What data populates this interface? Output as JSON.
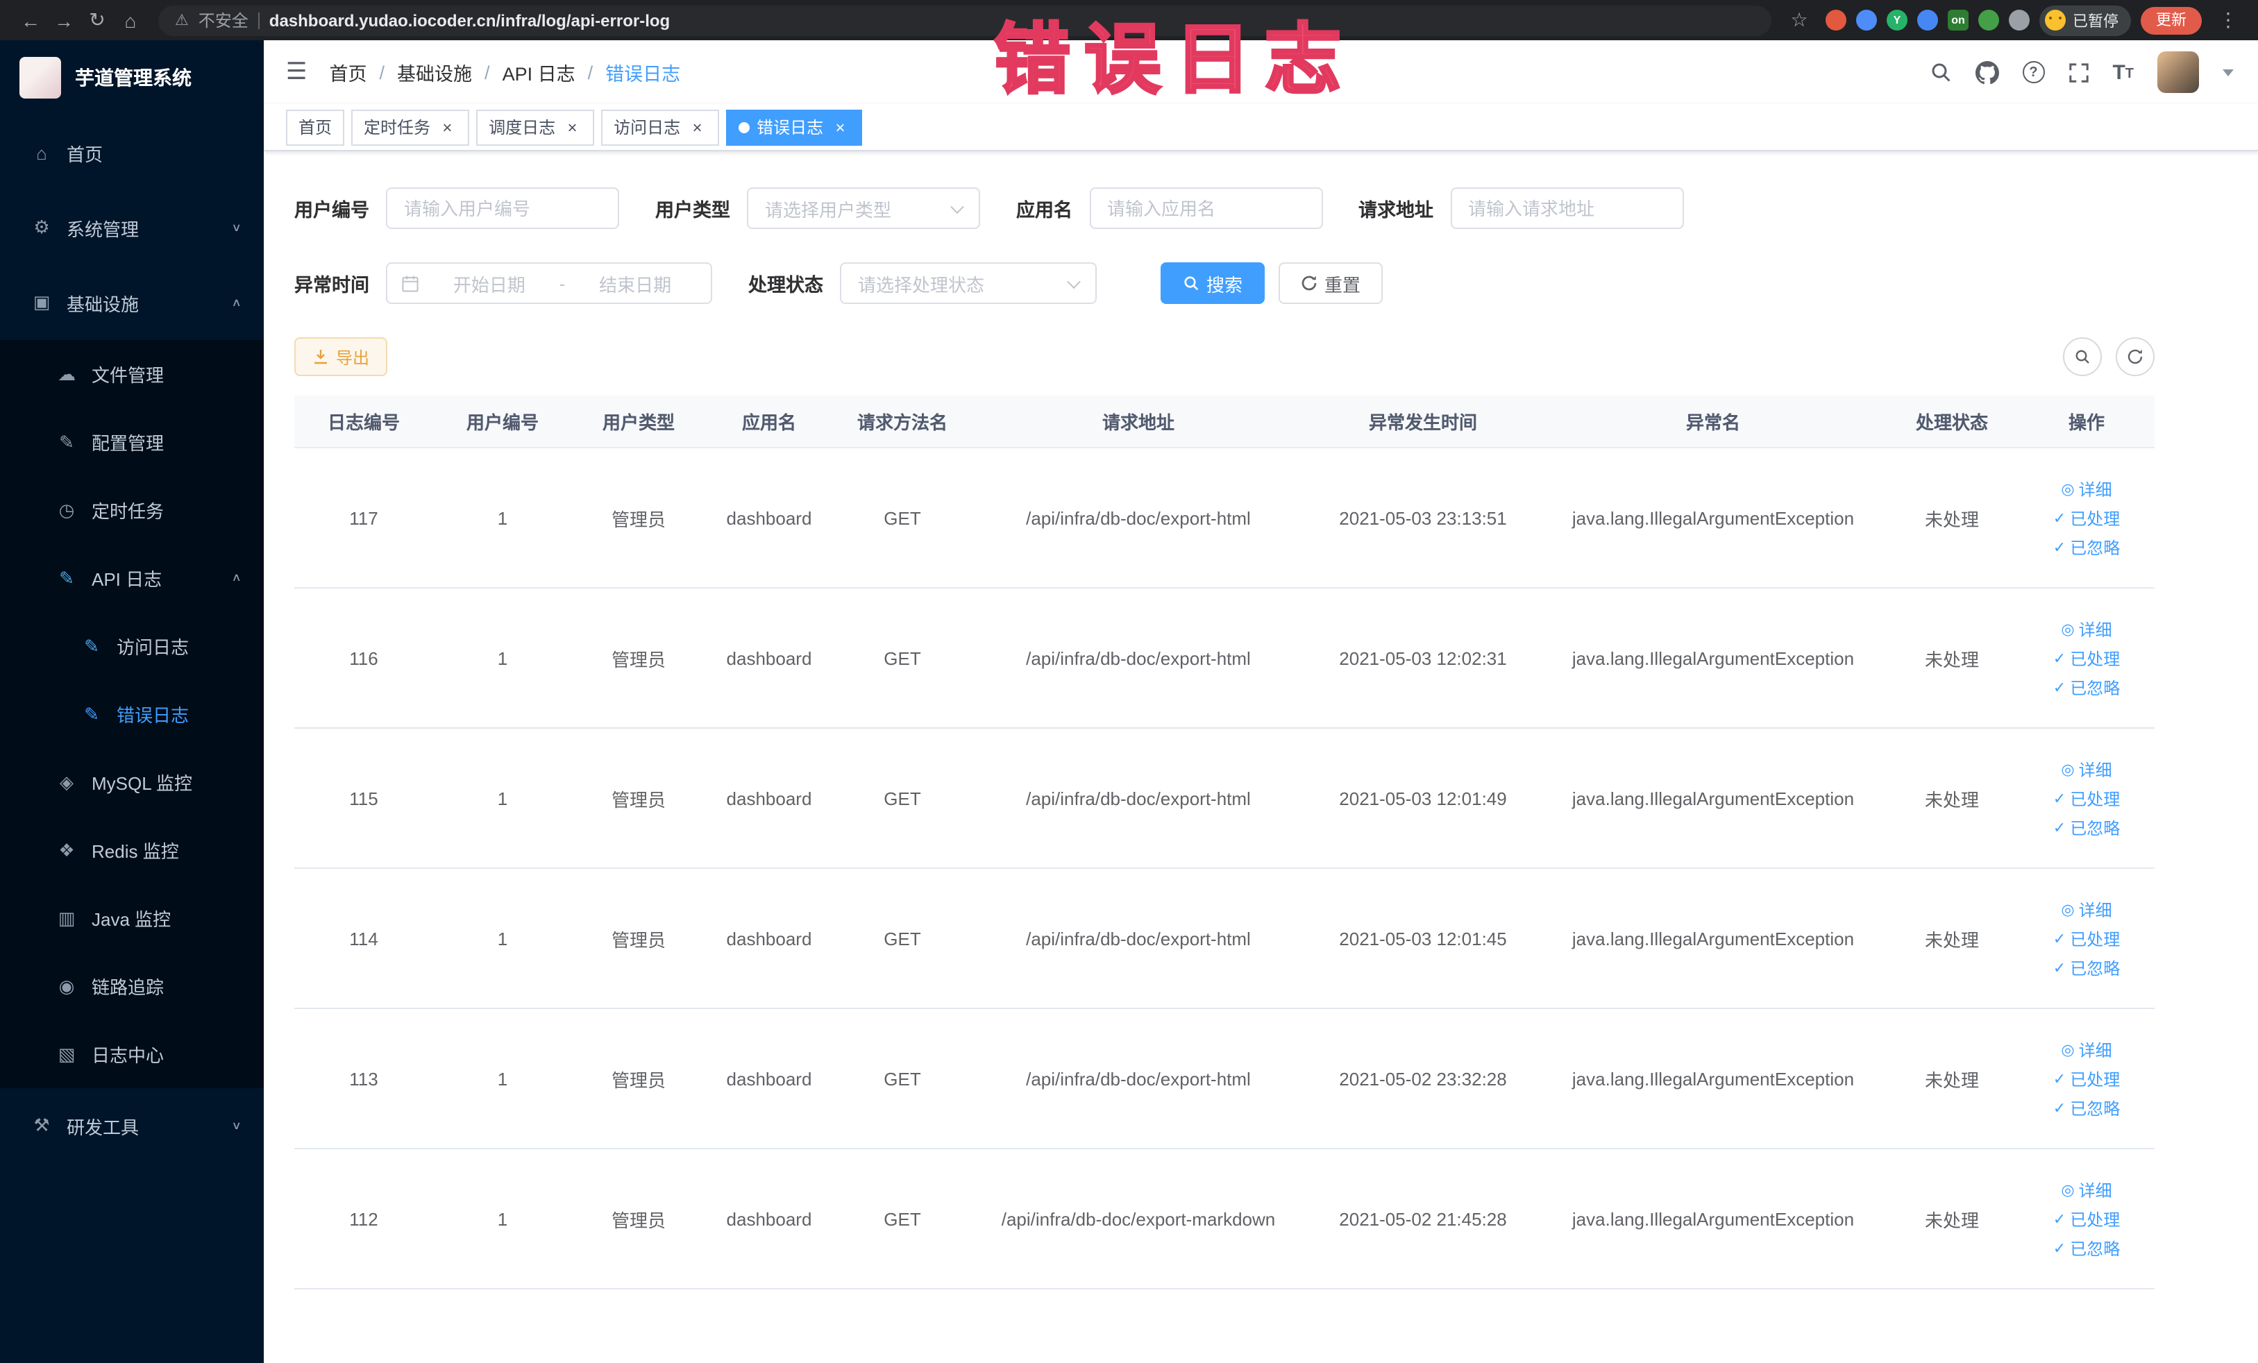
{
  "theme": {
    "primary": "#409eff",
    "sidebar_bg": "#001529",
    "submenu_bg": "#000c17",
    "warning_text": "#e6a23c",
    "warning_bg": "#fdf6ec",
    "warning_border": "#f5dab1",
    "annotation_color": "#f2557a"
  },
  "annotation": "错误日志",
  "browser": {
    "security_label": "不安全",
    "url": "dashboard.yudao.iocoder.cn/infra/log/api-error-log",
    "profile_badge": "已暂停",
    "update_label": "更新",
    "extensions": [
      {
        "name": "extension-orange-circle",
        "color": "#e2593f",
        "label": ""
      },
      {
        "name": "extension-blue-drop",
        "color": "#4e8cf7",
        "label": ""
      },
      {
        "name": "extension-green-y",
        "color": "#27b26a",
        "label": "Y"
      },
      {
        "name": "extension-blue-grid",
        "color": "#4687f4",
        "label": ""
      },
      {
        "name": "extension-on-badge",
        "color": "#2e7d32",
        "label": "on"
      },
      {
        "name": "extension-green-leaf",
        "color": "#43a047",
        "label": ""
      },
      {
        "name": "extension-pinwheel",
        "color": "#9aa0a6",
        "label": ""
      }
    ]
  },
  "sidebar": {
    "logo_title": "芋道管理系统",
    "items": [
      {
        "label": "首页",
        "icon": "home",
        "level": 1
      },
      {
        "label": "系统管理",
        "icon": "system",
        "level": 1,
        "chevron": "down"
      },
      {
        "label": "基础设施",
        "icon": "infra",
        "level": 1,
        "chevron": "up"
      },
      {
        "label": "文件管理",
        "icon": "file",
        "level": 2,
        "in_submenu": true
      },
      {
        "label": "配置管理",
        "icon": "config",
        "level": 2,
        "in_submenu": true
      },
      {
        "label": "定时任务",
        "icon": "cron",
        "level": 2,
        "in_submenu": true
      },
      {
        "label": "API 日志",
        "icon": "api-log",
        "level": 2,
        "in_submenu": true,
        "chevron": "up",
        "icon_accent": true
      },
      {
        "label": "访问日志",
        "icon": "access-log",
        "level": 3,
        "in_submenu": true,
        "icon_accent": true
      },
      {
        "label": "错误日志",
        "icon": "error-log",
        "level": 3,
        "in_submenu": true,
        "icon_accent": true,
        "active": true
      },
      {
        "label": "MySQL 监控",
        "icon": "mysql",
        "level": 2,
        "in_submenu": true
      },
      {
        "label": "Redis 监控",
        "icon": "redis",
        "level": 2,
        "in_submenu": true
      },
      {
        "label": "Java 监控",
        "icon": "java",
        "level": 2,
        "in_submenu": true
      },
      {
        "label": "链路追踪",
        "icon": "trace",
        "level": 2,
        "in_submenu": true
      },
      {
        "label": "日志中心",
        "icon": "log-center",
        "level": 2,
        "in_submenu": true
      },
      {
        "label": "研发工具",
        "icon": "devtools",
        "level": 1,
        "chevron": "down"
      }
    ]
  },
  "header": {
    "breadcrumb": [
      {
        "label": "首页"
      },
      {
        "label": "基础设施"
      },
      {
        "label": "API 日志"
      },
      {
        "label": "错误日志",
        "active": true
      }
    ]
  },
  "tabs": [
    {
      "label": "首页",
      "closable": false
    },
    {
      "label": "定时任务",
      "closable": true
    },
    {
      "label": "调度日志",
      "closable": true
    },
    {
      "label": "访问日志",
      "closable": true
    },
    {
      "label": "错误日志",
      "closable": true,
      "active": true
    }
  ],
  "filters": {
    "user_id_label": "用户编号",
    "user_id_placeholder": "请输入用户编号",
    "user_type_label": "用户类型",
    "user_type_placeholder": "请选择用户类型",
    "app_name_label": "应用名",
    "app_name_placeholder": "请输入应用名",
    "request_url_label": "请求地址",
    "request_url_placeholder": "请输入请求地址",
    "exception_time_label": "异常时间",
    "start_date_placeholder": "开始日期",
    "range_separator": "-",
    "end_date_placeholder": "结束日期",
    "process_status_label": "处理状态",
    "process_status_placeholder": "请选择处理状态",
    "search_button": "搜索",
    "reset_button": "重置"
  },
  "toolbar": {
    "export_button": "导出"
  },
  "table": {
    "columns": [
      "日志编号",
      "用户编号",
      "用户类型",
      "应用名",
      "请求方法名",
      "请求地址",
      "异常发生时间",
      "异常名",
      "处理状态",
      "操作"
    ],
    "actions": [
      "详细",
      "已处理",
      "已忽略"
    ],
    "rows": [
      {
        "id": "117",
        "user_id": "1",
        "user_type": "管理员",
        "app": "dashboard",
        "method": "GET",
        "url": "/api/infra/db-doc/export-html",
        "time": "2021-05-03 23:13:51",
        "exception": "java.lang.IllegalArgumentException",
        "status": "未处理"
      },
      {
        "id": "116",
        "user_id": "1",
        "user_type": "管理员",
        "app": "dashboard",
        "method": "GET",
        "url": "/api/infra/db-doc/export-html",
        "time": "2021-05-03 12:02:31",
        "exception": "java.lang.IllegalArgumentException",
        "status": "未处理"
      },
      {
        "id": "115",
        "user_id": "1",
        "user_type": "管理员",
        "app": "dashboard",
        "method": "GET",
        "url": "/api/infra/db-doc/export-html",
        "time": "2021-05-03 12:01:49",
        "exception": "java.lang.IllegalArgumentException",
        "status": "未处理"
      },
      {
        "id": "114",
        "user_id": "1",
        "user_type": "管理员",
        "app": "dashboard",
        "method": "GET",
        "url": "/api/infra/db-doc/export-html",
        "time": "2021-05-03 12:01:45",
        "exception": "java.lang.IllegalArgumentException",
        "status": "未处理"
      },
      {
        "id": "113",
        "user_id": "1",
        "user_type": "管理员",
        "app": "dashboard",
        "method": "GET",
        "url": "/api/infra/db-doc/export-html",
        "time": "2021-05-02 23:32:28",
        "exception": "java.lang.IllegalArgumentException",
        "status": "未处理"
      },
      {
        "id": "112",
        "user_id": "1",
        "user_type": "管理员",
        "app": "dashboard",
        "method": "GET",
        "url": "/api/infra/db-doc/export-markdown",
        "time": "2021-05-02 21:45:28",
        "exception": "java.lang.IllegalArgumentException",
        "status": "未处理"
      }
    ]
  }
}
